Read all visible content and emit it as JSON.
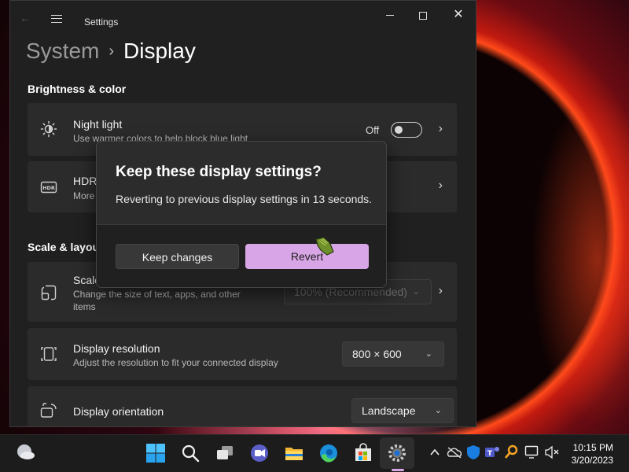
{
  "window": {
    "title": "Settings",
    "back_glyph": "←",
    "minimize_glyph": "",
    "maximize_glyph": "",
    "close_glyph": "✕"
  },
  "breadcrumb": {
    "parent": "System",
    "separator": "›",
    "current": "Display"
  },
  "sections": {
    "brightness_color": "Brightness & color",
    "scale_layout": "Scale & layout"
  },
  "night_light": {
    "icon": "brightness-icon",
    "title": "Night light",
    "subtitle": "Use warmer colors to help block blue light",
    "toggle_label": "Off",
    "toggle_on": false
  },
  "hdr": {
    "icon": "hdr-icon",
    "title": "HDR",
    "subtitle": "More"
  },
  "scale": {
    "icon": "scale-icon",
    "title": "Scale",
    "subtitle_line1": "Change the size of text, apps, and other",
    "subtitle_line2": "items",
    "value": "100% (Recommended)"
  },
  "resolution": {
    "icon": "resolution-icon",
    "title": "Display resolution",
    "subtitle": "Adjust the resolution to fit your connected display",
    "value": "800 × 600"
  },
  "orientation": {
    "icon": "orientation-icon",
    "title": "Display orientation",
    "value": "Landscape"
  },
  "dialog": {
    "title": "Keep these display settings?",
    "message": "Reverting to previous display settings in 13 seconds.",
    "keep_label": "Keep changes",
    "revert_label": "Revert"
  },
  "taskbar": {
    "time": "10:15 PM",
    "date": "3/20/2023",
    "icons": [
      "weather-icon",
      "windows-start-icon",
      "search-icon",
      "task-view-icon",
      "teams-chat-icon",
      "file-explorer-icon",
      "edge-icon",
      "store-icon",
      "settings-icon"
    ],
    "tray_icons": [
      "chevron-up-icon",
      "onedrive-icon",
      "defender-icon",
      "teams-icon",
      "key-icon",
      "network-icon",
      "volume-mute-icon"
    ]
  },
  "colors": {
    "accent": "#d8a6e6",
    "window_bg": "#202020",
    "card_bg": "#2b2b2b"
  }
}
